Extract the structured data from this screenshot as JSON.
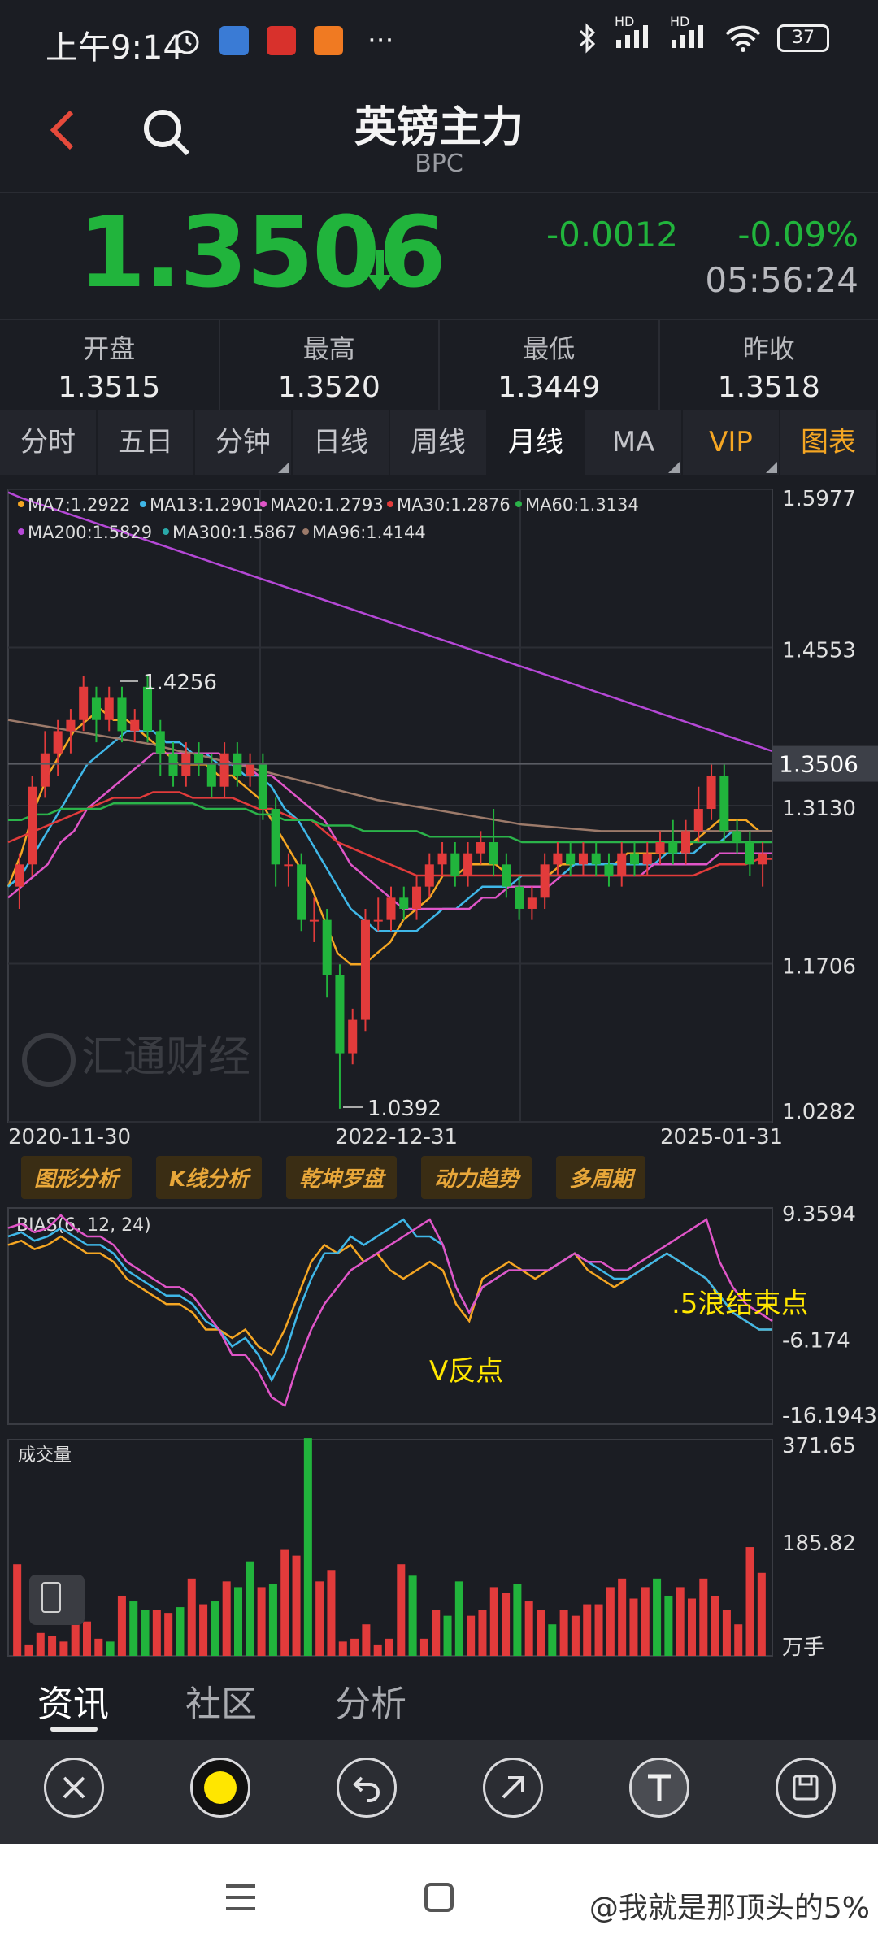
{
  "status_bar": {
    "time": "上午9:14",
    "battery": "37",
    "signal1": "HD",
    "signal2": "HD",
    "more": "···"
  },
  "header": {
    "title": "英镑主力",
    "code": "BPC"
  },
  "quote": {
    "price": "1.3506",
    "change": "-0.0012",
    "change_pct": "-0.09%",
    "time": "05:56:24",
    "color": "#21b43c"
  },
  "stats": [
    {
      "label": "开盘",
      "value": "1.3515"
    },
    {
      "label": "最高",
      "value": "1.3520"
    },
    {
      "label": "最低",
      "value": "1.3449"
    },
    {
      "label": "昨收",
      "value": "1.3518"
    }
  ],
  "tabs": [
    "分时",
    "五日",
    "分钟",
    "日线",
    "周线",
    "月线",
    "MA",
    "VIP",
    "图表"
  ],
  "active_tab": "月线",
  "chart_data": [
    {
      "type": "line",
      "title": "",
      "ma_legend": [
        {
          "name": "MA7:1.2922",
          "color": "#f5a623"
        },
        {
          "name": "MA13:1.2901",
          "color": "#3fb7e8"
        },
        {
          "name": "MA20:1.2793",
          "color": "#e055c8"
        },
        {
          "name": "MA30:1.2876",
          "color": "#e23b3b"
        },
        {
          "name": "MA60:1.3134",
          "color": "#2bb34a"
        },
        {
          "name": "MA200:1.5829",
          "color": "#b548d6"
        },
        {
          "name": "MA300:1.5867",
          "color": "#2aa9a9"
        },
        {
          "name": "MA96:1.4144",
          "color": "#9c7a6a"
        }
      ],
      "y_ticks": [
        "1.5977",
        "1.4553",
        "1.3130",
        "1.1706",
        "1.0282"
      ],
      "current_price_label": "1.3506",
      "x_ticks": [
        "2020-11-30",
        "2022-12-31",
        "2025-01-31"
      ],
      "annotations": {
        "high": "1.4256",
        "low": "1.0392"
      },
      "watermark": "汇通财经",
      "ylim": [
        1.0282,
        1.5977
      ],
      "candles": [
        [
          1.24,
          1.26,
          1.27,
          1.22
        ],
        [
          1.26,
          1.33,
          1.34,
          1.25
        ],
        [
          1.33,
          1.36,
          1.38,
          1.32
        ],
        [
          1.36,
          1.38,
          1.39,
          1.34
        ],
        [
          1.38,
          1.39,
          1.4,
          1.36
        ],
        [
          1.39,
          1.42,
          1.43,
          1.38
        ],
        [
          1.41,
          1.39,
          1.42,
          1.37
        ],
        [
          1.39,
          1.41,
          1.42,
          1.38
        ],
        [
          1.41,
          1.38,
          1.42,
          1.37
        ],
        [
          1.38,
          1.39,
          1.4,
          1.37
        ],
        [
          1.42,
          1.38,
          1.43,
          1.37
        ],
        [
          1.38,
          1.36,
          1.39,
          1.34
        ],
        [
          1.36,
          1.34,
          1.37,
          1.33
        ],
        [
          1.34,
          1.36,
          1.37,
          1.33
        ],
        [
          1.36,
          1.35,
          1.37,
          1.34
        ],
        [
          1.35,
          1.33,
          1.36,
          1.32
        ],
        [
          1.33,
          1.36,
          1.37,
          1.32
        ],
        [
          1.36,
          1.34,
          1.37,
          1.33
        ],
        [
          1.34,
          1.35,
          1.36,
          1.33
        ],
        [
          1.35,
          1.31,
          1.36,
          1.3
        ],
        [
          1.31,
          1.26,
          1.32,
          1.24
        ],
        [
          1.26,
          1.26,
          1.27,
          1.24
        ],
        [
          1.26,
          1.21,
          1.27,
          1.2
        ],
        [
          1.21,
          1.21,
          1.23,
          1.19
        ],
        [
          1.21,
          1.16,
          1.22,
          1.14
        ],
        [
          1.16,
          1.09,
          1.17,
          1.04
        ],
        [
          1.09,
          1.12,
          1.13,
          1.08
        ],
        [
          1.12,
          1.21,
          1.22,
          1.11
        ],
        [
          1.21,
          1.21,
          1.23,
          1.2
        ],
        [
          1.21,
          1.23,
          1.24,
          1.2
        ],
        [
          1.23,
          1.22,
          1.24,
          1.21
        ],
        [
          1.22,
          1.24,
          1.25,
          1.21
        ],
        [
          1.24,
          1.26,
          1.27,
          1.23
        ],
        [
          1.26,
          1.27,
          1.28,
          1.25
        ],
        [
          1.27,
          1.25,
          1.28,
          1.24
        ],
        [
          1.25,
          1.27,
          1.28,
          1.24
        ],
        [
          1.27,
          1.28,
          1.29,
          1.26
        ],
        [
          1.28,
          1.26,
          1.31,
          1.25
        ],
        [
          1.26,
          1.24,
          1.27,
          1.23
        ],
        [
          1.24,
          1.22,
          1.25,
          1.21
        ],
        [
          1.22,
          1.23,
          1.24,
          1.21
        ],
        [
          1.23,
          1.26,
          1.27,
          1.22
        ],
        [
          1.26,
          1.27,
          1.28,
          1.25
        ],
        [
          1.27,
          1.26,
          1.28,
          1.25
        ],
        [
          1.26,
          1.27,
          1.28,
          1.25
        ],
        [
          1.27,
          1.26,
          1.28,
          1.25
        ],
        [
          1.26,
          1.25,
          1.27,
          1.24
        ],
        [
          1.25,
          1.27,
          1.28,
          1.24
        ],
        [
          1.27,
          1.26,
          1.28,
          1.25
        ],
        [
          1.26,
          1.27,
          1.28,
          1.25
        ],
        [
          1.27,
          1.28,
          1.29,
          1.26
        ],
        [
          1.28,
          1.27,
          1.3,
          1.26
        ],
        [
          1.27,
          1.29,
          1.3,
          1.26
        ],
        [
          1.29,
          1.31,
          1.33,
          1.28
        ],
        [
          1.31,
          1.34,
          1.35,
          1.3
        ],
        [
          1.34,
          1.29,
          1.35,
          1.28
        ],
        [
          1.29,
          1.28,
          1.3,
          1.27
        ],
        [
          1.28,
          1.26,
          1.29,
          1.25
        ],
        [
          1.26,
          1.27,
          1.28,
          1.24
        ]
      ],
      "volumes": [
        160,
        20,
        40,
        35,
        25,
        110,
        60,
        30,
        25,
        105,
        95,
        80,
        80,
        75,
        85,
        135,
        90,
        95,
        130,
        120,
        165,
        120,
        125,
        185,
        175,
        380,
        130,
        150,
        25,
        30,
        55,
        20,
        30,
        160,
        140,
        30,
        80,
        70,
        130,
        70,
        80,
        120,
        110,
        125,
        95,
        80,
        55,
        80,
        70,
        90,
        90,
        120,
        135,
        100,
        120,
        135,
        105,
        120,
        100,
        135,
        105,
        80,
        55,
        190,
        145
      ],
      "ma_lines": {
        "MA7": [
          1.24,
          1.27,
          1.31,
          1.34,
          1.36,
          1.38,
          1.39,
          1.4,
          1.39,
          1.39,
          1.38,
          1.37,
          1.36,
          1.35,
          1.35,
          1.35,
          1.34,
          1.34,
          1.33,
          1.32,
          1.3,
          1.28,
          1.26,
          1.24,
          1.21,
          1.18,
          1.17,
          1.17,
          1.18,
          1.19,
          1.21,
          1.22,
          1.23,
          1.25,
          1.25,
          1.26,
          1.26,
          1.26,
          1.25,
          1.25,
          1.25,
          1.25,
          1.26,
          1.26,
          1.26,
          1.26,
          1.26,
          1.27,
          1.27,
          1.27,
          1.27,
          1.27,
          1.28,
          1.29,
          1.3,
          1.3,
          1.3,
          1.29,
          1.29
        ],
        "MA13": [
          1.24,
          1.25,
          1.27,
          1.29,
          1.31,
          1.33,
          1.35,
          1.36,
          1.37,
          1.38,
          1.38,
          1.38,
          1.37,
          1.37,
          1.36,
          1.36,
          1.35,
          1.35,
          1.34,
          1.34,
          1.33,
          1.31,
          1.3,
          1.28,
          1.26,
          1.24,
          1.22,
          1.21,
          1.2,
          1.2,
          1.2,
          1.2,
          1.21,
          1.22,
          1.22,
          1.23,
          1.24,
          1.24,
          1.24,
          1.25,
          1.25,
          1.25,
          1.25,
          1.26,
          1.26,
          1.26,
          1.26,
          1.26,
          1.26,
          1.26,
          1.27,
          1.27,
          1.27,
          1.28,
          1.28,
          1.29,
          1.29,
          1.29,
          1.29
        ],
        "MA20": [
          1.23,
          1.24,
          1.25,
          1.26,
          1.28,
          1.29,
          1.31,
          1.32,
          1.33,
          1.34,
          1.35,
          1.36,
          1.36,
          1.36,
          1.36,
          1.36,
          1.36,
          1.35,
          1.35,
          1.34,
          1.34,
          1.33,
          1.32,
          1.31,
          1.3,
          1.28,
          1.26,
          1.25,
          1.24,
          1.23,
          1.22,
          1.22,
          1.22,
          1.22,
          1.22,
          1.22,
          1.23,
          1.23,
          1.24,
          1.24,
          1.24,
          1.24,
          1.25,
          1.25,
          1.25,
          1.25,
          1.25,
          1.25,
          1.25,
          1.26,
          1.26,
          1.26,
          1.26,
          1.26,
          1.27,
          1.27,
          1.27,
          1.27,
          1.27
        ],
        "MA30": [
          1.28,
          1.285,
          1.29,
          1.295,
          1.3,
          1.305,
          1.31,
          1.315,
          1.32,
          1.32,
          1.32,
          1.325,
          1.325,
          1.325,
          1.32,
          1.32,
          1.32,
          1.32,
          1.315,
          1.31,
          1.31,
          1.305,
          1.3,
          1.3,
          1.29,
          1.28,
          1.275,
          1.27,
          1.265,
          1.26,
          1.255,
          1.25,
          1.25,
          1.25,
          1.25,
          1.25,
          1.25,
          1.25,
          1.25,
          1.25,
          1.25,
          1.25,
          1.25,
          1.25,
          1.25,
          1.25,
          1.25,
          1.25,
          1.25,
          1.25,
          1.25,
          1.25,
          1.25,
          1.255,
          1.26,
          1.26,
          1.26,
          1.265,
          1.265
        ],
        "MA60": [
          1.3,
          1.3,
          1.305,
          1.305,
          1.31,
          1.31,
          1.31,
          1.31,
          1.315,
          1.315,
          1.315,
          1.315,
          1.315,
          1.315,
          1.315,
          1.31,
          1.31,
          1.31,
          1.31,
          1.305,
          1.305,
          1.3,
          1.3,
          1.3,
          1.295,
          1.295,
          1.295,
          1.29,
          1.29,
          1.29,
          1.29,
          1.29,
          1.285,
          1.285,
          1.285,
          1.285,
          1.285,
          1.285,
          1.285,
          1.28,
          1.28,
          1.28,
          1.28,
          1.28,
          1.28,
          1.28,
          1.28,
          1.28,
          1.28,
          1.28,
          1.28,
          1.28,
          1.28,
          1.28,
          1.28,
          1.28,
          1.28,
          1.28,
          1.28
        ],
        "MA96": [
          1.39,
          1.388,
          1.386,
          1.384,
          1.382,
          1.38,
          1.378,
          1.376,
          1.374,
          1.372,
          1.37,
          1.368,
          1.365,
          1.362,
          1.36,
          1.357,
          1.354,
          1.351,
          1.348,
          1.345,
          1.342,
          1.339,
          1.336,
          1.333,
          1.33,
          1.327,
          1.324,
          1.321,
          1.318,
          1.316,
          1.314,
          1.312,
          1.31,
          1.308,
          1.306,
          1.304,
          1.302,
          1.3,
          1.298,
          1.296,
          1.295,
          1.294,
          1.293,
          1.292,
          1.291,
          1.29,
          1.29,
          1.29,
          1.29,
          1.29,
          1.29,
          1.29,
          1.29,
          1.29,
          1.29,
          1.29,
          1.29,
          1.29,
          1.29
        ],
        "MA200": [
          1.595,
          1.59,
          1.586,
          1.582,
          1.578,
          1.574,
          1.57,
          1.566,
          1.562,
          1.558,
          1.554,
          1.55,
          1.546,
          1.542,
          1.538,
          1.534,
          1.53,
          1.526,
          1.522,
          1.518,
          1.514,
          1.51,
          1.506,
          1.502,
          1.498,
          1.494,
          1.49,
          1.486,
          1.482,
          1.478,
          1.474,
          1.47,
          1.466,
          1.462,
          1.458,
          1.454,
          1.45,
          1.446,
          1.442,
          1.438,
          1.434,
          1.43,
          1.426,
          1.422,
          1.418,
          1.414,
          1.41,
          1.406,
          1.402,
          1.398,
          1.394,
          1.39,
          1.386,
          1.382,
          1.378,
          1.374,
          1.37,
          1.366,
          1.362
        ]
      }
    },
    {
      "type": "line",
      "title": "BIAS(6, 12, 24)",
      "y_ticks": [
        "9.3594",
        "-6.174",
        "-16.1943"
      ],
      "ylim": [
        -16.1943,
        9.3594
      ],
      "annotations": [
        ".5浪结束点",
        "V反点"
      ],
      "series": [
        {
          "color": "#f5a623",
          "values": [
            5,
            5.5,
            4.5,
            5,
            6,
            5,
            4,
            4,
            3,
            1,
            0,
            -1,
            -2,
            -2,
            -3,
            -5,
            -5,
            -6,
            -5,
            -7,
            -8,
            -5,
            -1,
            3,
            5,
            4,
            5,
            3,
            4,
            2,
            1,
            2,
            3,
            2,
            -2,
            -4,
            1,
            2,
            3,
            2,
            1,
            2,
            3,
            4,
            2,
            1,
            0,
            1,
            2,
            3,
            4,
            3,
            2,
            1,
            -1,
            -3,
            -4,
            -5,
            -5
          ]
        },
        {
          "color": "#3fb7e8",
          "values": [
            6,
            6.5,
            5.5,
            6,
            7,
            6,
            5,
            5,
            4,
            2,
            1,
            0,
            -1,
            -1,
            -2,
            -4,
            -5,
            -7,
            -6,
            -8,
            -11,
            -8,
            -3,
            1,
            4,
            4,
            6,
            5,
            6,
            7,
            8,
            6,
            6,
            5,
            0,
            -3,
            0,
            1,
            2,
            2,
            2,
            2,
            3,
            4,
            3,
            2,
            1,
            1,
            2,
            3,
            4,
            3,
            2,
            1,
            -1,
            -3,
            -4,
            -5,
            -5
          ]
        },
        {
          "color": "#e055c8",
          "values": [
            7,
            7.5,
            6.5,
            7,
            8.5,
            7,
            6,
            6,
            5,
            3,
            2,
            1,
            0,
            0,
            -1,
            -3,
            -5,
            -8,
            -8,
            -10,
            -13,
            -14,
            -9,
            -5,
            -2,
            0,
            2,
            3,
            4,
            5,
            6,
            7,
            8,
            5,
            0,
            -3,
            0,
            1,
            2,
            2,
            2,
            2,
            3,
            4,
            3,
            3,
            2,
            2,
            3,
            4,
            5,
            6,
            7,
            8,
            3,
            0,
            -2,
            -3,
            -4
          ]
        }
      ]
    },
    {
      "type": "bar",
      "title": "成交量",
      "y_ticks": [
        "371.65",
        "185.82"
      ],
      "unit": "万手"
    }
  ],
  "chips": [
    "图形分析",
    "K线分析",
    "乾坤罗盘",
    "动力趋势",
    "多周期"
  ],
  "bottom_tabs": [
    "资讯",
    "社区",
    "分析"
  ],
  "watermark": "@我就是那顶头的5%"
}
